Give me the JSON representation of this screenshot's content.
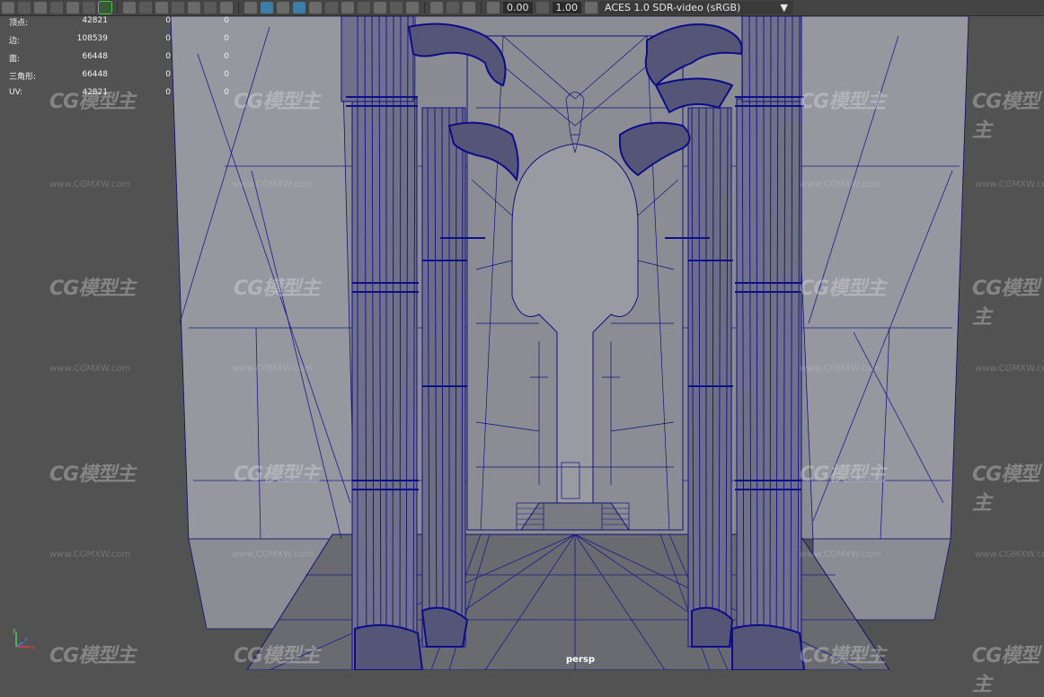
{
  "toolbar": {
    "icons": [
      "camera-icon",
      "camera-select-icon",
      "bookmark-icon",
      "camera-attr-icon",
      "image-plane-icon",
      "grease-pencil-icon",
      "grid-icon",
      "film-gate-icon",
      "resolution-gate-icon",
      "gate-mask-icon",
      "field-chart-icon",
      "safe-action-icon",
      "safe-title-icon",
      "wireframe-icon",
      "smooth-shade-icon",
      "default-material-icon",
      "wireframe-on-shaded-icon",
      "xray-icon",
      "lights-icon",
      "shadows-icon",
      "ambient-occlusion-icon",
      "motion-blur-icon",
      "anti-alias-icon",
      "depth-of-field-icon",
      "isolate-select-icon",
      "xray-joints-icon",
      "camera-exposure-icon",
      "gamma-icon",
      "color-management-icon"
    ],
    "exposure_value": "0.00",
    "gamma_value": "1.00",
    "color_space": "ACES 1.0 SDR-video (sRGB)"
  },
  "hud": {
    "rows": [
      {
        "label": "顶点:",
        "v1": "42821",
        "v2": "0",
        "v3": "0"
      },
      {
        "label": "边:",
        "v1": "108539",
        "v2": "0",
        "v3": "0"
      },
      {
        "label": "面:",
        "v1": "66448",
        "v2": "0",
        "v3": "0"
      },
      {
        "label": "三角形:",
        "v1": "66448",
        "v2": "0",
        "v3": "0"
      },
      {
        "label": "UV:",
        "v1": "42821",
        "v2": "0",
        "v3": "0"
      }
    ]
  },
  "camera_label": "persp",
  "axis": {
    "x": "x",
    "y": "y",
    "z": "z"
  },
  "watermark": {
    "logo": "CG模型主",
    "url": "www.CGMXW.com"
  },
  "colors": {
    "wire": "#0c0e8c",
    "background": "#525252",
    "wall": "#8d8d95",
    "floor": "#6d6d74"
  }
}
